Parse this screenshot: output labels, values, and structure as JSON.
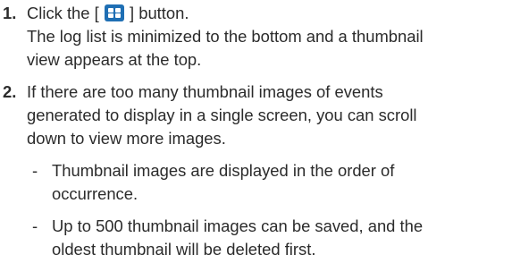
{
  "steps": [
    {
      "number": "1.",
      "line1_before": "Click the [",
      "line1_icon": "grid-view-icon",
      "line1_after": "] button.",
      "lines": [
        "The log list is minimized to the bottom and a thumbnail",
        "view appears at the top."
      ]
    },
    {
      "number": "2.",
      "lines": [
        "If there are too many thumbnail images of events",
        "generated to display in a single screen, you can scroll",
        "down to view more images."
      ],
      "bullets": [
        {
          "dash": "-",
          "lines": [
            "Thumbnail images are displayed in the order of",
            "occurrence."
          ]
        },
        {
          "dash": "-",
          "lines": [
            "Up to 500 thumbnail images can be saved, and the",
            "oldest thumbnail will be deleted first."
          ]
        }
      ]
    }
  ],
  "colors": {
    "text": "#2b2b2b",
    "icon_button": "#1f6fb4"
  }
}
